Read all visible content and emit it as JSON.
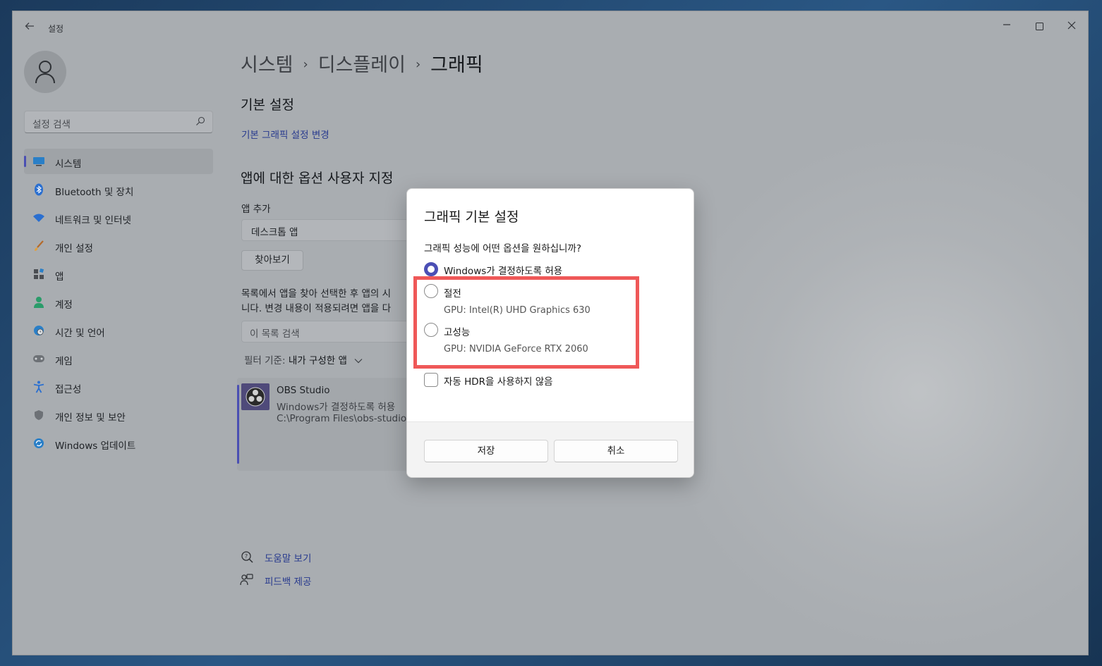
{
  "window": {
    "title": "설정",
    "back_icon": "arrow-left-icon",
    "controls": [
      "minimize-icon",
      "maximize-icon",
      "close-icon"
    ]
  },
  "sidebar": {
    "search_placeholder": "설정 검색",
    "items": [
      {
        "label": "시스템",
        "icon": "monitor-icon",
        "active": true
      },
      {
        "label": "Bluetooth 및 장치",
        "icon": "bluetooth-icon"
      },
      {
        "label": "네트워크 및 인터넷",
        "icon": "wifi-icon"
      },
      {
        "label": "개인 설정",
        "icon": "brush-icon"
      },
      {
        "label": "앱",
        "icon": "apps-icon"
      },
      {
        "label": "계정",
        "icon": "person-icon"
      },
      {
        "label": "시간 및 언어",
        "icon": "globe-clock-icon"
      },
      {
        "label": "게임",
        "icon": "gamepad-icon"
      },
      {
        "label": "접근성",
        "icon": "accessibility-icon"
      },
      {
        "label": "개인 정보 및 보안",
        "icon": "shield-icon"
      },
      {
        "label": "Windows 업데이트",
        "icon": "update-icon"
      }
    ]
  },
  "main": {
    "breadcrumb": [
      "시스템",
      "디스플레이",
      "그래픽"
    ],
    "basic_heading": "기본 설정",
    "basic_link": "기본 그래픽 설정 변경",
    "custom_heading": "앱에 대한 옵션 사용자 지정",
    "add_app_label": "앱 추가",
    "add_app_value": "데스크톱 앱",
    "browse_button": "찾아보기",
    "description_line1": "목록에서 앱을 찾아 선택한 후 앱의 시",
    "description_line2": "니다. 변경 내용이 적용되려면 앱을 다",
    "list_search_placeholder": "이 목록 검색",
    "filter_label": "필터 기준:",
    "filter_value": "내가 구성한 앱",
    "app": {
      "name": "OBS Studio",
      "setting": "Windows가 결정하도록 허용",
      "path": "C:\\Program Files\\obs-studio"
    },
    "help_link": "도움말 보기",
    "feedback_link": "피드백 제공"
  },
  "dialog": {
    "title": "그래픽 기본 설정",
    "question": "그래픽 성능에 어떤 옵션을 원하십니까?",
    "options": [
      {
        "label": "Windows가 결정하도록 허용",
        "checked": true
      },
      {
        "label": "절전",
        "sub": "GPU: Intel(R) UHD Graphics 630",
        "checked": false
      },
      {
        "label": "고성능",
        "sub": "GPU: NVIDIA GeForce RTX 2060",
        "checked": false
      }
    ],
    "hdr_checkbox": "자동 HDR을 사용하지 않음",
    "save_button": "저장",
    "cancel_button": "취소"
  },
  "colors": {
    "accent": "#4b4fb5",
    "highlight": "#ef5858",
    "link": "#283a8e"
  }
}
